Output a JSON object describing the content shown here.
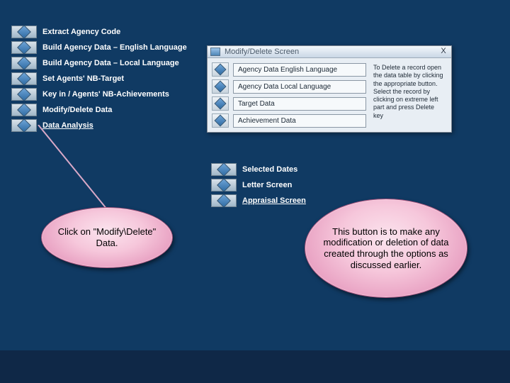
{
  "left_menu": {
    "items": [
      {
        "label": "Extract Agency Code",
        "underline": false
      },
      {
        "label": "Build  Agency Data – English Language",
        "underline": false
      },
      {
        "label": "Build Agency Data – Local Language",
        "underline": false
      },
      {
        "label": "Set  Agents' NB-Target",
        "underline": false
      },
      {
        "label": "Key in / Agents' NB-Achievements",
        "underline": false
      },
      {
        "label": "Modify/Delete Data",
        "underline": false
      },
      {
        "label": "Data Analysis",
        "underline": true
      }
    ]
  },
  "center_menu": {
    "items": [
      {
        "label": "Selected Dates"
      },
      {
        "label": "Letter Screen"
      },
      {
        "label": "Appraisal  Screen",
        "underline": true
      }
    ]
  },
  "dialog": {
    "title": "Modify/Delete Screen",
    "close": "X",
    "options": [
      "Agency Data  English Language",
      "Agency Data Local Language",
      "Target Data",
      "Achievement Data"
    ],
    "help": "To Delete a record open the data table by clicking the appropriate button. Select the record by clicking on extreme left part and press Delete key"
  },
  "callouts": {
    "left": "Click on \"Modify\\Delete\" Data.",
    "right": "This button is to make any modification or deletion of data created through the options as discussed earlier."
  }
}
